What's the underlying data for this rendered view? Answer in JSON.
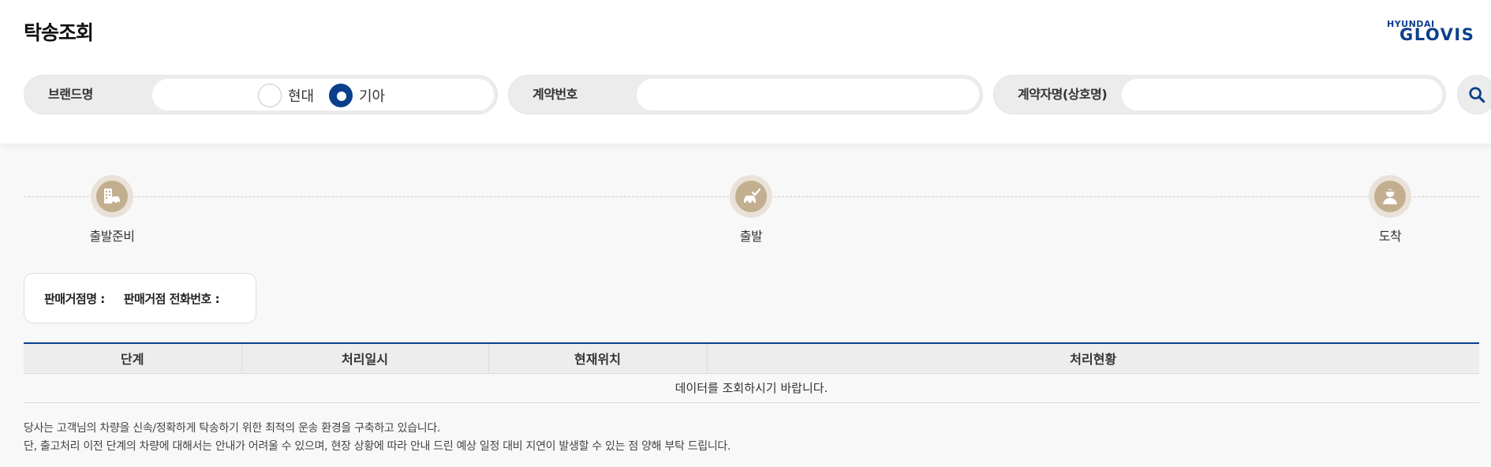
{
  "header": {
    "title": "탁송조회",
    "logo_top": "HYUNDAI",
    "logo_bottom": "GLOVIS"
  },
  "search": {
    "brand_label": "브랜드명",
    "brand_options": [
      {
        "label": "현대",
        "selected": false
      },
      {
        "label": "기아",
        "selected": true
      }
    ],
    "contract_label": "계약번호",
    "contract_value": "",
    "name_label": "계약자명(상호명)",
    "name_value": "",
    "search_icon": "search-icon"
  },
  "steps": [
    {
      "label": "출발준비",
      "icon": "building-car-icon"
    },
    {
      "label": "출발",
      "icon": "car-check-icon"
    },
    {
      "label": "도착",
      "icon": "person-icon"
    }
  ],
  "dealer": {
    "name_label": "판매거점명 :",
    "phone_label": "판매거점 전화번호 :"
  },
  "table": {
    "headers": [
      "단계",
      "처리일시",
      "현재위치",
      "처리현황"
    ],
    "empty_message": "데이터를 조회하시기 바랍니다."
  },
  "notes": [
    "당사는 고객님의 차량을 신속/정확하게 탁송하기 위한 최적의 운송 환경을 구축하고 있습니다.",
    "단, 출고처리 이전 단계의 차량에 대해서는 안내가 어려울 수 있으며, 현장 상황에 따라 안내 드린 예상 일정 대비 지연이 발생할 수 있는 점 양해 부탁 드립니다."
  ],
  "colors": {
    "brand_navy": "#0b3f8c",
    "step_tan": "#c3ae90"
  }
}
